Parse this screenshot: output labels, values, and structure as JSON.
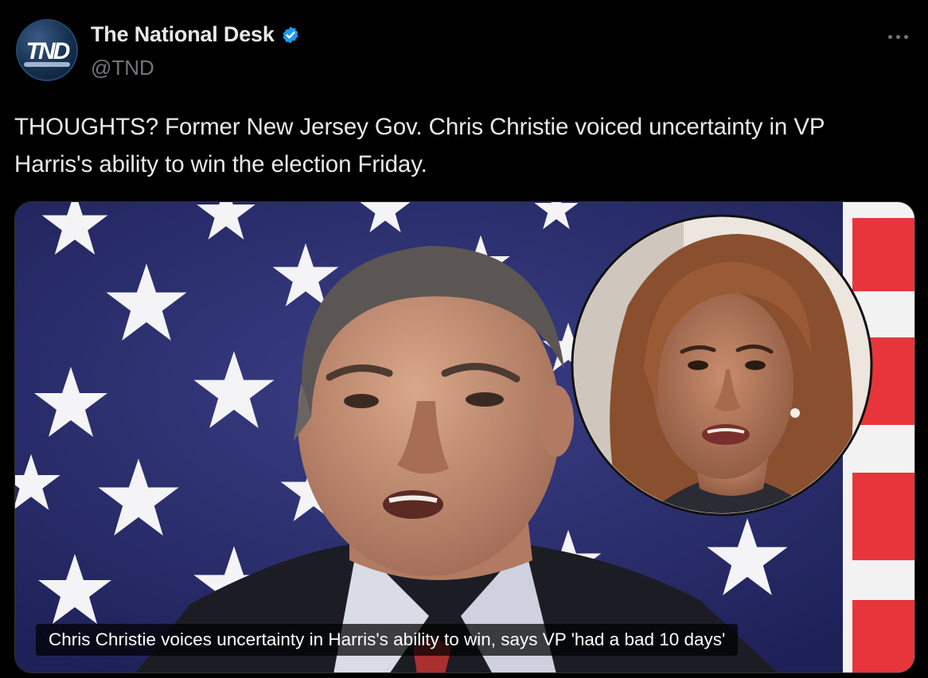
{
  "account": {
    "display_name": "The National Desk",
    "handle": "@TND",
    "avatar_text": "TND",
    "verified": true
  },
  "tweet": {
    "text": "THOUGHTS? Former New Jersey Gov. Chris Christie voiced uncertainty in VP Harris's ability to win the election Friday."
  },
  "media": {
    "caption": "Chris Christie voices uncertainty in Harris's ability to win, says VP 'had a bad 10 days'"
  },
  "icons": {
    "verified": "verified-badge-icon",
    "more": "more-options-icon"
  },
  "colors": {
    "background": "#000000",
    "text": "#e7e9ea",
    "muted": "#71767b",
    "verified": "#1d9bf0",
    "flag_blue": "#2c2f6e",
    "flag_red": "#e8353c"
  }
}
